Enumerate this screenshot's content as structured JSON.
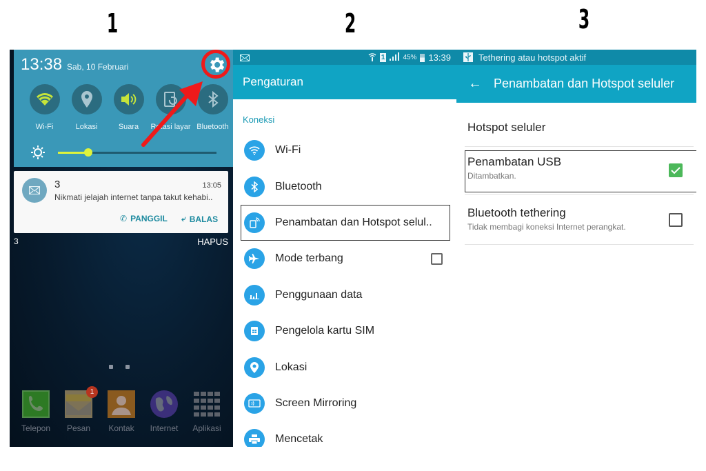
{
  "steps": [
    "1",
    "2",
    "3"
  ],
  "panel1": {
    "clock": "13:38",
    "date": "Sab, 10 Februari",
    "settings_icon": "gear-icon",
    "quick_toggles": [
      {
        "label": "Wi-Fi",
        "icon": "wifi-icon",
        "active": true
      },
      {
        "label": "Lokasi",
        "icon": "location-icon",
        "active": false
      },
      {
        "label": "Suara",
        "icon": "volume-icon",
        "active": true
      },
      {
        "label": "Rotasi layar",
        "icon": "rotate-icon",
        "active": false
      },
      {
        "label": "Bluetooth",
        "icon": "bluetooth-icon",
        "active": false
      }
    ],
    "brightness": 0.19,
    "notification": {
      "sender": "3",
      "time": "13:05",
      "message": "Nikmati jelajah internet tanpa takut kehabi..",
      "actions": [
        "PANGGIL",
        "BALAS"
      ]
    },
    "notification_count": "3",
    "clear_label": "HAPUS",
    "dock_apps": [
      {
        "label": "Telepon",
        "icon": "phone-icon"
      },
      {
        "label": "Pesan",
        "icon": "messages-icon",
        "badge": "1"
      },
      {
        "label": "Kontak",
        "icon": "contacts-icon"
      },
      {
        "label": "Internet",
        "icon": "globe-icon"
      },
      {
        "label": "Aplikasi",
        "icon": "apps-grid-icon"
      }
    ],
    "colors": {
      "shade": "#3a98b8",
      "accent": "#dff33b",
      "annotation": "#ef1a1a"
    }
  },
  "panel2": {
    "status_bar": {
      "battery": "45%",
      "time": "13:39",
      "sim": "1"
    },
    "title": "Pengaturan",
    "category": "Koneksi",
    "items": [
      {
        "label": "Wi-Fi",
        "icon": "wifi-icon"
      },
      {
        "label": "Bluetooth",
        "icon": "bluetooth-icon"
      },
      {
        "label": "Penambatan dan Hotspot selul..",
        "icon": "hotspot-icon",
        "highlighted": true
      },
      {
        "label": "Mode terbang",
        "icon": "airplane-icon",
        "checkbox": false
      },
      {
        "label": "Penggunaan data",
        "icon": "data-usage-icon"
      },
      {
        "label": "Pengelola kartu SIM",
        "icon": "sim-card-icon"
      },
      {
        "label": "Lokasi",
        "icon": "location-icon"
      },
      {
        "label": "Screen Mirroring",
        "icon": "screen-mirroring-icon"
      },
      {
        "label": "Mencetak",
        "icon": "printer-icon"
      }
    ],
    "colors": {
      "header": "#10a4c4",
      "icon": "#2aa3e6",
      "category": "#1d9bb5"
    }
  },
  "panel3": {
    "status_bar_text": "Tethering atau hotspot aktif",
    "title": "Penambatan dan Hotspot seluler",
    "items": [
      {
        "title": "Hotspot seluler"
      },
      {
        "title": "Penambatan USB",
        "subtitle": "Ditambatkan.",
        "checked": true,
        "highlighted": true
      },
      {
        "title": "Bluetooth tethering",
        "subtitle": "Tidak membagi koneksi Internet perangkat.",
        "checked": false
      }
    ],
    "colors": {
      "checked": "#4cb85a"
    }
  }
}
